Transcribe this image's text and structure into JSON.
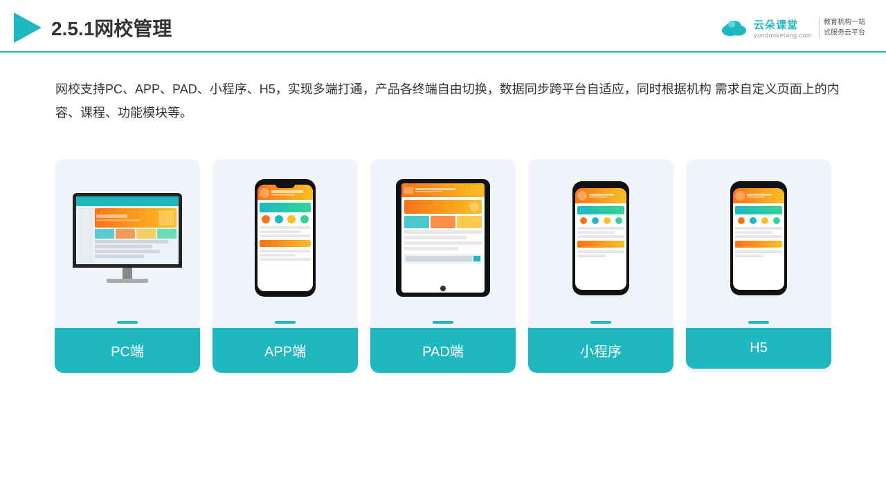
{
  "header": {
    "title": "2.5.1网校管理",
    "brand": {
      "name": "云朵课堂",
      "url": "yunduoketang.com",
      "slogan": "教育机构一站\n式服务云平台"
    }
  },
  "description": "网校支持PC、APP、PAD、小程序、H5，实现多端打通，产品各终端自由切换，数据同步跨平台自适应，同时根据机构\n需求自定义页面上的内容、课程、功能模块等。",
  "cards": [
    {
      "id": "pc",
      "label": "PC端",
      "device": "pc"
    },
    {
      "id": "app",
      "label": "APP端",
      "device": "phone"
    },
    {
      "id": "pad",
      "label": "PAD端",
      "device": "tablet"
    },
    {
      "id": "miniprogram",
      "label": "小程序",
      "device": "miniphone"
    },
    {
      "id": "h5",
      "label": "H5",
      "device": "miniphone2"
    }
  ],
  "colors": {
    "accent": "#1fb8c1",
    "orange": "#f97316",
    "yellow": "#fbbf24",
    "bg_card": "#f0f4fa",
    "text_main": "#333333"
  }
}
